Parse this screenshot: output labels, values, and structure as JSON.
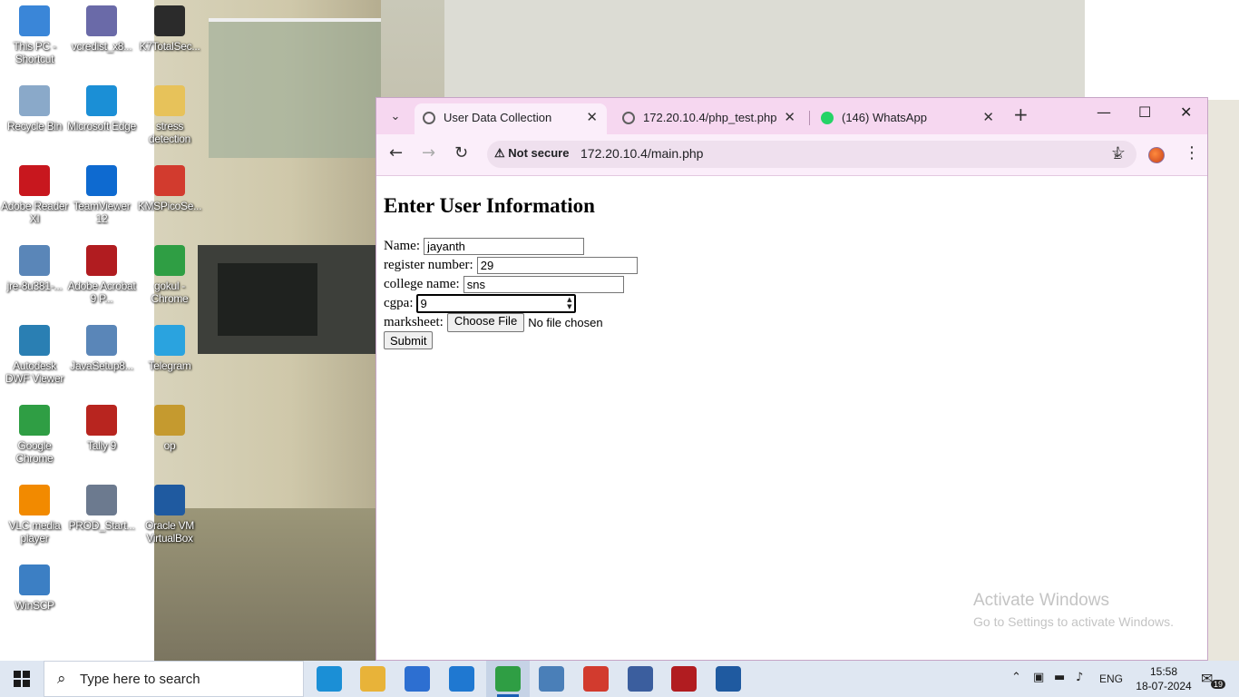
{
  "desktop": {
    "icons": [
      {
        "label": "This PC - Shortcut",
        "icon": "this-pc-icon",
        "color": "#3a86d8"
      },
      {
        "label": "vcredist_x8...",
        "icon": "installer-icon",
        "color": "#6a6aa8"
      },
      {
        "label": "K7TotalSec...",
        "icon": "k7-icon",
        "color": "#2b2b2b"
      },
      {
        "label": "Recycle Bin",
        "icon": "recycle-bin-icon",
        "color": "#8aa9c9"
      },
      {
        "label": "Microsoft Edge",
        "icon": "edge-icon",
        "color": "#1b8fd6"
      },
      {
        "label": "stress detection",
        "icon": "folder-icon",
        "color": "#e7c25a"
      },
      {
        "label": "Adobe Reader XI",
        "icon": "adobe-reader-icon",
        "color": "#c8171e"
      },
      {
        "label": "TeamViewer 12",
        "icon": "teamviewer-icon",
        "color": "#0e6ad0"
      },
      {
        "label": "KMSPicoSe...",
        "icon": "kmspico-icon",
        "color": "#d23b2e"
      },
      {
        "label": "jre-8u381-...",
        "icon": "java-icon",
        "color": "#5a86b8"
      },
      {
        "label": "Adobe Acrobat 9 P...",
        "icon": "acrobat-icon",
        "color": "#b11c20"
      },
      {
        "label": "gokul - Chrome",
        "icon": "chrome-icon",
        "color": "#2f9e44"
      },
      {
        "label": "Autodesk DWF Viewer",
        "icon": "autodesk-icon",
        "color": "#2a7fb3"
      },
      {
        "label": "JavaSetup8...",
        "icon": "java-icon",
        "color": "#5a86b8"
      },
      {
        "label": "Telegram",
        "icon": "telegram-icon",
        "color": "#2aa3df"
      },
      {
        "label": "Google Chrome",
        "icon": "chrome-icon",
        "color": "#2f9e44"
      },
      {
        "label": "Tally 9",
        "icon": "tally-icon",
        "color": "#b8251f"
      },
      {
        "label": "op",
        "icon": "image-file-icon",
        "color": "#c59a2f"
      },
      {
        "label": "VLC media player",
        "icon": "vlc-icon",
        "color": "#f28a00"
      },
      {
        "label": "PROD_Start...",
        "icon": "window-file-icon",
        "color": "#6c7a8f"
      },
      {
        "label": "Oracle VM VirtualBox",
        "icon": "virtualbox-icon",
        "color": "#1f5aa0"
      },
      {
        "label": "WinSCP",
        "icon": "winscp-icon",
        "color": "#3c7fc4"
      }
    ]
  },
  "browser": {
    "tabs": [
      {
        "title": "User Data Collection",
        "icon": "globe-icon",
        "active": true
      },
      {
        "title": "172.20.10.4/php_test.php",
        "icon": "globe-icon",
        "active": false
      },
      {
        "title": "(146) WhatsApp",
        "icon": "whatsapp-icon",
        "active": false
      }
    ],
    "security_chip": "Not secure",
    "url": "172.20.10.4/main.php"
  },
  "page": {
    "heading": "Enter User Information",
    "fields": {
      "name": {
        "label": "Name:",
        "value": "jayanth"
      },
      "register": {
        "label": "register number:",
        "value": "29"
      },
      "college": {
        "label": "college name:",
        "value": "sns"
      },
      "cgpa": {
        "label": "cgpa:",
        "value": "9"
      },
      "marksheet": {
        "label": "marksheet:",
        "button": "Choose File",
        "status": "No file chosen"
      }
    },
    "submit": "Submit"
  },
  "watermark": {
    "line1": "Activate Windows",
    "line2": "Go to Settings to activate Windows."
  },
  "taskbar": {
    "search_placeholder": "Type here to search",
    "language": "ENG",
    "time": "15:58",
    "date": "18-07-2024",
    "notification_count": "19",
    "apps": [
      {
        "icon": "edge-icon",
        "color": "#1b8fd6"
      },
      {
        "icon": "file-explorer-icon",
        "color": "#e8b339"
      },
      {
        "icon": "store-icon",
        "color": "#2d6fd1"
      },
      {
        "icon": "mail-icon",
        "color": "#1f78d1"
      },
      {
        "icon": "chrome-icon",
        "color": "#2f9e44"
      },
      {
        "icon": "laptop-icon",
        "color": "#4a7fb8"
      },
      {
        "icon": "app-red-icon",
        "color": "#d23b2e"
      },
      {
        "icon": "network-tool-icon",
        "color": "#3b5e9e"
      },
      {
        "icon": "acrobat-icon",
        "color": "#b11c20"
      },
      {
        "icon": "virtualbox-icon",
        "color": "#1f5aa0"
      }
    ]
  }
}
